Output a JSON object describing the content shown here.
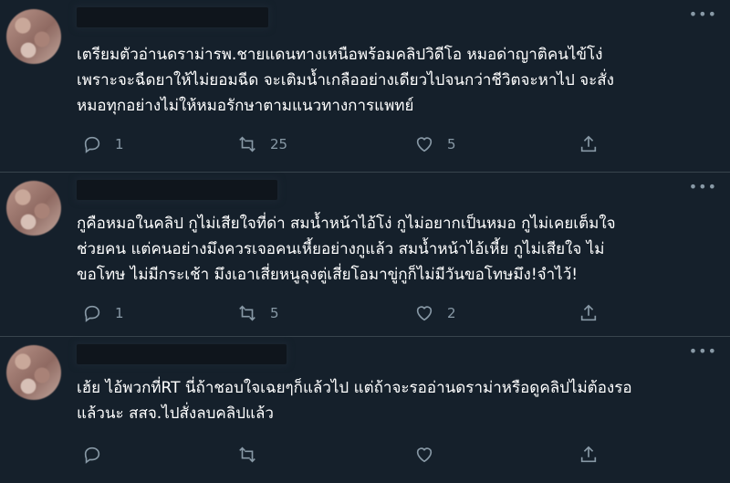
{
  "tweets": [
    {
      "text": "เตรียมตัวอ่านดราม่ารพ.ชายแดนทางเหนือพร้อมคลิปวิดีโอ หมอด่าญาติคนไข้โง่\nเพราะจะฉีดยาให้ไม่ยอมฉีด จะเติมน้ำเกลืออย่างเดียวไปจนกว่าชีวิตจะหาไป จะสั่ง\nหมอทุกอย่างไม่ให้หมอรักษาตามแนวทางการแพทย์",
      "reply_count": "1",
      "retweet_count": "25",
      "like_count": "5"
    },
    {
      "text": "กูคือหมอในคลิป กูไม่เสียใจที่ด่า สมน้ำหน้าไอ้โง่ กูไม่อยากเป็นหมอ กูไม่เคยเต็มใจ\nช่วยคน แต่คนอย่างมึงควรเจอคนเหี้ยอย่างกูแล้ว สมน้ำหน้าไอ้เหี้ย กูไม่เสียใจ ไม่\nขอโทษ ไม่มีกระเช้า มึงเอาเสี่ยหนูลุงตู่เสี่ยโอมาขู่กูก็ไม่มีวันขอโทษมึง!จำไว้!",
      "reply_count": "1",
      "retweet_count": "5",
      "like_count": "2"
    },
    {
      "text": "เฮ้ย ไอ้พวกที่RT นี่ถ้าชอบใจเฉยๆก็แล้วไป แต่ถ้าจะรออ่านดราม่าหรือดูคลิปไม่ต้องรอ\nแล้วนะ สสจ.ไปสั่งลบคลิปแล้ว",
      "reply_count": "",
      "retweet_count": "",
      "like_count": ""
    }
  ],
  "more_icon": "ellipsis-icon",
  "colors": {
    "background": "#15202b",
    "text": "#ffffff",
    "muted": "#8899a6",
    "divider": "#38444d"
  }
}
